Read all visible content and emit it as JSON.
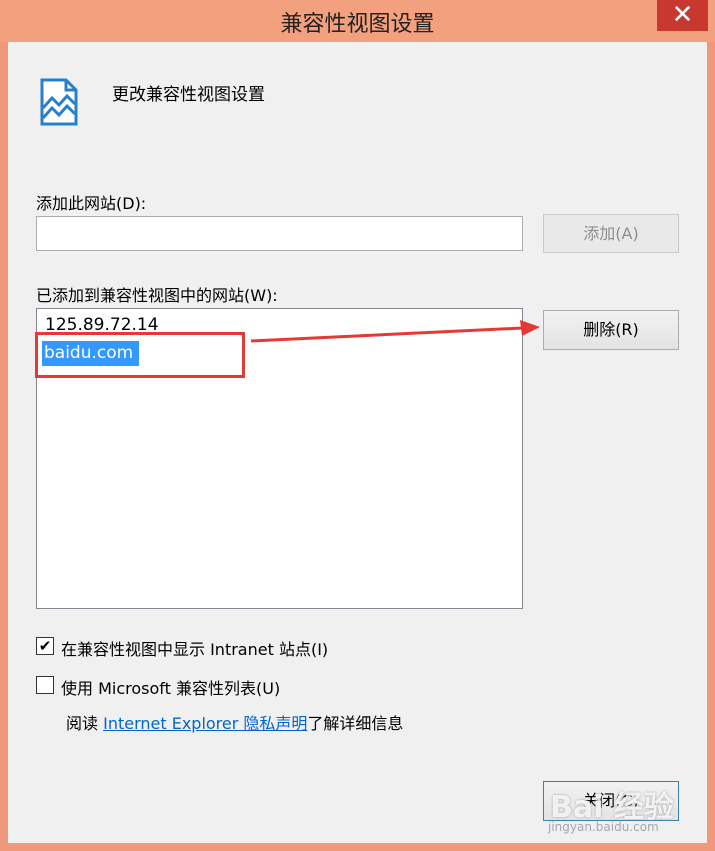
{
  "window": {
    "title": "兼容性视图设置",
    "close_glyph": "✕"
  },
  "header": {
    "text": "更改兼容性视图设置",
    "icon": "document-compatibility-icon"
  },
  "add_section": {
    "label": "添加此网站(D):",
    "input_value": "",
    "add_button": "添加(A)"
  },
  "list_section": {
    "label": "已添加到兼容性视图中的网站(W):",
    "items": [
      "125.89.72.14",
      "baidu.com"
    ],
    "selected_index": 1,
    "remove_button": "删除(R)"
  },
  "options": {
    "intranet": {
      "label": "在兼容性视图中显示 Intranet 站点(I)",
      "checked": true
    },
    "ms_list": {
      "label": "使用 Microsoft 兼容性列表(U)",
      "checked": false
    }
  },
  "privacy": {
    "prefix": "阅读 ",
    "link": "Internet Explorer 隐私声明",
    "suffix": "了解详细信息"
  },
  "footer": {
    "close_button": "关闭(C)"
  },
  "watermark": {
    "text": "Bai 经验",
    "sub": "jingyan.baidu.com"
  },
  "colors": {
    "title_bar": "#f2a07d",
    "close_button": "#c7392e",
    "selection": "#3399ff",
    "annotation": "#e53935",
    "link": "#0066cc"
  }
}
